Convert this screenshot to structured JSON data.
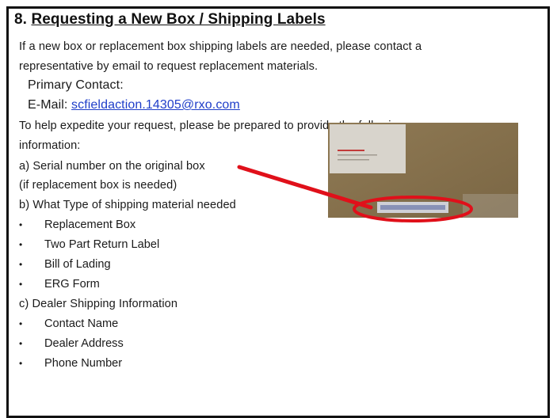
{
  "heading": {
    "number": "8.",
    "title": "Requesting a New Box / Shipping Labels"
  },
  "intro_line1": "If a new box or replacement box shipping labels are needed, please contact a",
  "intro_line2": "representative by email to request replacement materials.",
  "primary_contact_label": "Primary Contact:",
  "email_label": "E-Mail:",
  "email_address": "scfieldaction.14305@rxo.com",
  "expedite_line1": "To help expedite your request, please be prepared to provide the following",
  "expedite_line2": "information:",
  "item_a": "a) Serial number on the original box",
  "item_a_note": "(if replacement box is needed)",
  "item_b": "b) What Type of shipping material needed",
  "shipping_materials": [
    "Replacement Box",
    "Two Part Return Label",
    "Bill of Lading",
    "ERG Form"
  ],
  "item_c": "c) Dealer Shipping Information",
  "dealer_info": [
    "Contact Name",
    "Dealer Address",
    "Phone Number"
  ],
  "bullet_char": "•",
  "colors": {
    "link": "#1f3ec9",
    "annotation": "#e0101a",
    "box_brown": "#8c7550"
  }
}
